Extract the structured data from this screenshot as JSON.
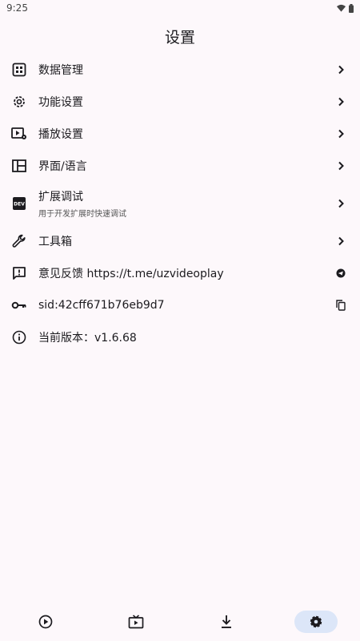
{
  "status_bar": {
    "time": "9:25"
  },
  "title": "设置",
  "items": [
    {
      "label": "数据管理",
      "icon": "grid-icon"
    },
    {
      "label": "功能设置",
      "icon": "gear-icon"
    },
    {
      "label": "播放设置",
      "icon": "play-settings-icon"
    },
    {
      "label": "界面/语言",
      "icon": "layout-icon"
    },
    {
      "label": "扩展调试",
      "sub": "用于开发扩展时快速调试",
      "icon": "dev-icon"
    },
    {
      "label": "工具箱",
      "icon": "wrench-icon"
    },
    {
      "label": "意见反馈 https://t.me/uzvideoplay",
      "icon": "feedback-icon"
    },
    {
      "label": "sid:42cff671b76eb9d7",
      "icon": "key-icon"
    },
    {
      "label": "当前版本：v1.6.68",
      "icon": "info-icon"
    }
  ],
  "nav": [
    "play-circle-icon",
    "tv-icon",
    "download-icon",
    "gear-icon"
  ],
  "colors": {
    "background": "#fdf8fb",
    "nav_active": "#dce6f8",
    "text": "#1c1b1f"
  }
}
